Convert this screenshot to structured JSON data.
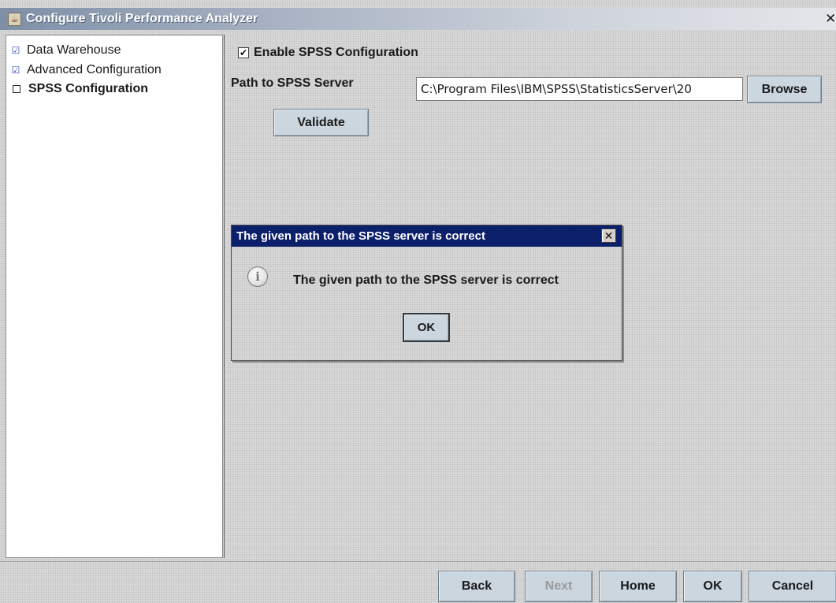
{
  "window": {
    "title": "Configure Tivoli Performance Analyzer",
    "app_icon": "java-cup-icon",
    "close_glyph": "✕"
  },
  "nav": {
    "items": [
      {
        "label": "Data Warehouse",
        "state": "checked",
        "mark": "☑"
      },
      {
        "label": "Advanced Configuration",
        "state": "checked",
        "mark": "☑"
      },
      {
        "label": "SPSS Configuration",
        "state": "current",
        "mark": ""
      }
    ]
  },
  "main": {
    "enable_checkbox": {
      "label": "Enable SPSS Configuration",
      "checked": true,
      "mark": "✔"
    },
    "path_label": "Path to SPSS Server",
    "path_value": "C:\\Program Files\\IBM\\SPSS\\StatisticsServer\\20",
    "browse_label": "Browse",
    "validate_label": "Validate"
  },
  "dialog": {
    "title": "The given path to the SPSS server is correct",
    "close_glyph": "✕",
    "icon": "info-icon",
    "icon_glyph": "i",
    "message": "The given path to the SPSS server is correct",
    "ok_label": "OK"
  },
  "footer": {
    "back_label": "Back",
    "next_label": "Next",
    "next_enabled": false,
    "home_label": "Home",
    "ok_label": "OK",
    "cancel_label": "Cancel"
  },
  "colors": {
    "dialog_title_bg": "#0c1f6b",
    "button_bg": "#cbd6df",
    "nav_check": "#3a46b8"
  }
}
